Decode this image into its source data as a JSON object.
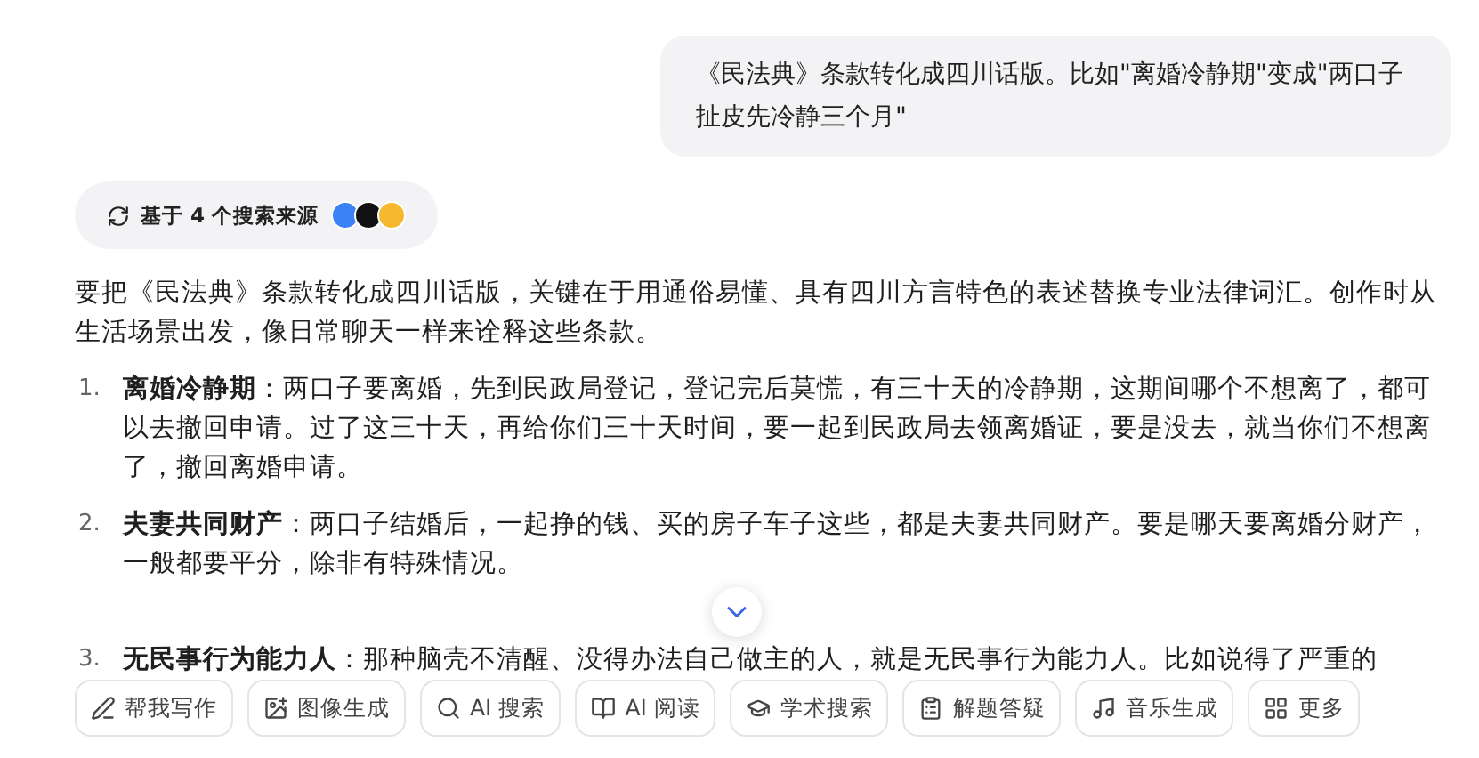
{
  "user_message": "《民法典》条款转化成四川话版。比如\"离婚冷静期\"变成\"两口子扯皮先冷静三个月\"",
  "sources": {
    "label": "基于 4 个搜索来源"
  },
  "intro": "要把《民法典》条款转化成四川话版，关键在于用通俗易懂、具有四川方言特色的表述替换专业法律词汇。创作时从生活场景出发，像日常聊天一样来诠释这些条款。",
  "items": [
    {
      "number": "1.",
      "term": "离婚冷静期",
      "text": "：两口子要离婚，先到民政局登记，登记完后莫慌，有三十天的冷静期，这期间哪个不想离了，都可以去撤回申请。过了这三十天，再给你们三十天时间，要一起到民政局去领离婚证，要是没去，就当你们不想离了，撤回离婚申请。"
    },
    {
      "number": "2.",
      "term": "夫妻共同财产",
      "text": "：两口子结婚后，一起挣的钱、买的房子车子这些，都是夫妻共同财产。要是哪天要离婚分财产，一般都要平分，除非有特殊情况。"
    },
    {
      "number": "3.",
      "term": "无民事行为能力人",
      "text": "：那种脑壳不清醒、没得办法自己做主的人，就是无民事行为能力人。比如说得了严重的"
    }
  ],
  "tools": [
    {
      "label": "帮我写作",
      "kind": "pen"
    },
    {
      "label": "图像生成",
      "kind": "image"
    },
    {
      "label": "AI 搜索",
      "kind": "search"
    },
    {
      "label": "AI 阅读",
      "kind": "read"
    },
    {
      "label": "学术搜索",
      "kind": "cap"
    },
    {
      "label": "解题答疑",
      "kind": "solve"
    },
    {
      "label": "音乐生成",
      "kind": "music"
    },
    {
      "label": "更多",
      "kind": "more"
    }
  ]
}
